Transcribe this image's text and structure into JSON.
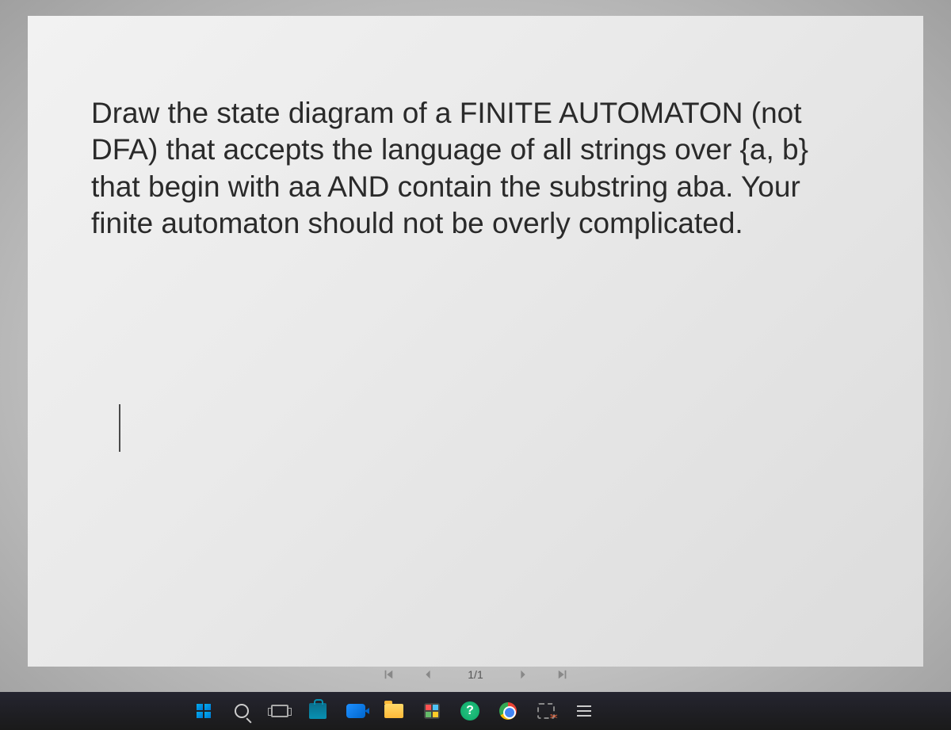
{
  "document": {
    "question_text": "Draw the state diagram of a FINITE AUTOMATON (not DFA) that accepts the language of all strings over {a, b} that begin with aa AND contain the substring aba. Your finite automaton should not be overly complicated."
  },
  "pagination": {
    "current_page": "1/1"
  },
  "taskbar": {
    "help_symbol": "?"
  }
}
